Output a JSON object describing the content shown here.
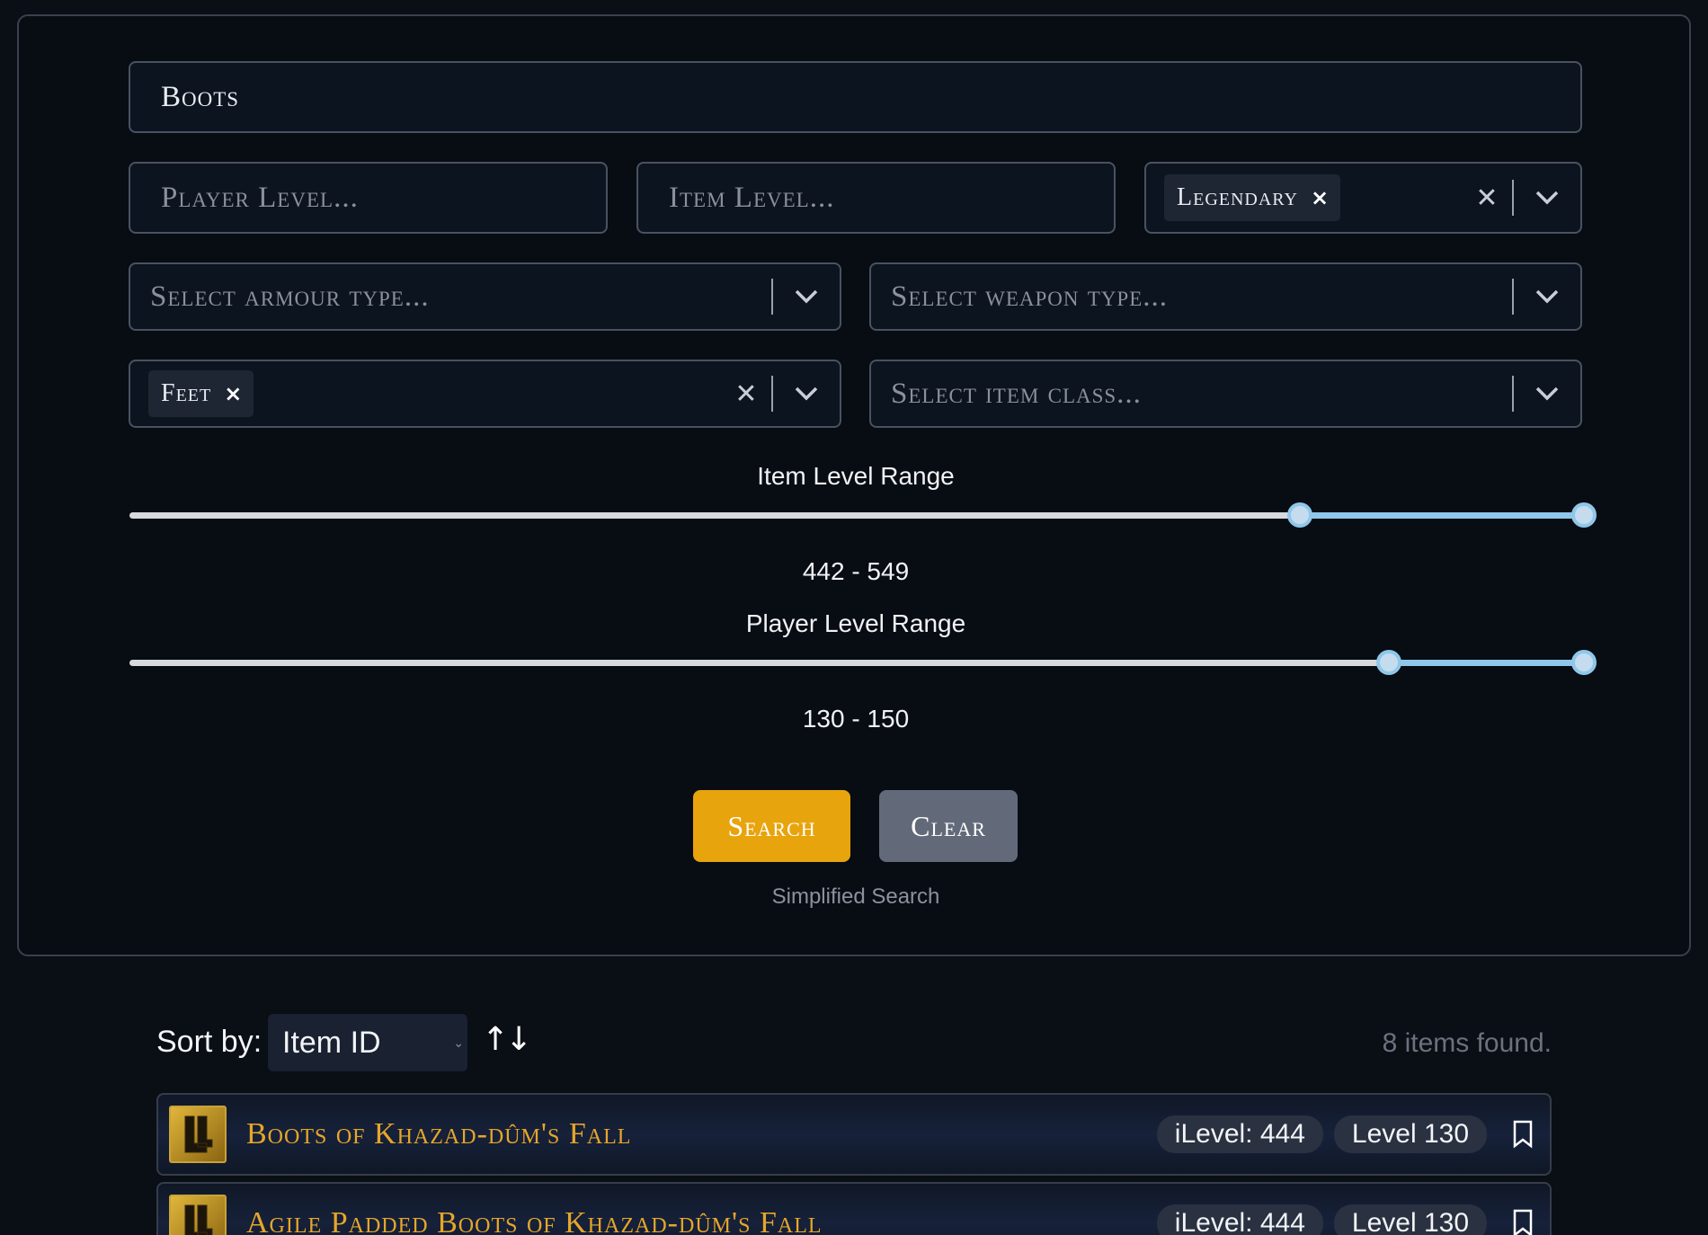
{
  "search": {
    "query": "Boots",
    "player_level_placeholder": "Player Level...",
    "item_level_placeholder": "Item Level...",
    "rarity_tag": "Legendary",
    "armour_type_placeholder": "Select armour type...",
    "weapon_type_placeholder": "Select weapon type...",
    "slot_tag": "Feet",
    "item_class_placeholder": "Select item class..."
  },
  "item_level_range": {
    "label": "Item Level Range",
    "value_text": "442 - 549",
    "min_value": 442,
    "max_value": 549,
    "low_fraction": 0.805,
    "high_fraction": 1.0
  },
  "player_level_range": {
    "label": "Player Level Range",
    "value_text": "130 - 150",
    "min_value": 130,
    "max_value": 150,
    "low_fraction": 0.866,
    "high_fraction": 1.0
  },
  "buttons": {
    "search": "Search",
    "clear": "Clear",
    "mode_link": "Simplified Search"
  },
  "results": {
    "sort_label": "Sort by:",
    "sort_value": "Item ID",
    "sort_direction_icon": "↑↓",
    "count_text": "8 items found.",
    "items": [
      {
        "name": "Boots of Khazad-dûm's Fall",
        "ilevel": "iLevel: 444",
        "level": "Level 130"
      },
      {
        "name": "Agile Padded Boots of Khazad-dûm's Fall",
        "ilevel": "iLevel: 444",
        "level": "Level 130"
      }
    ]
  },
  "colors": {
    "accent_gold": "#e8a40c",
    "item_name": "#e6a62a",
    "slider_fill": "#8fc7ea"
  }
}
